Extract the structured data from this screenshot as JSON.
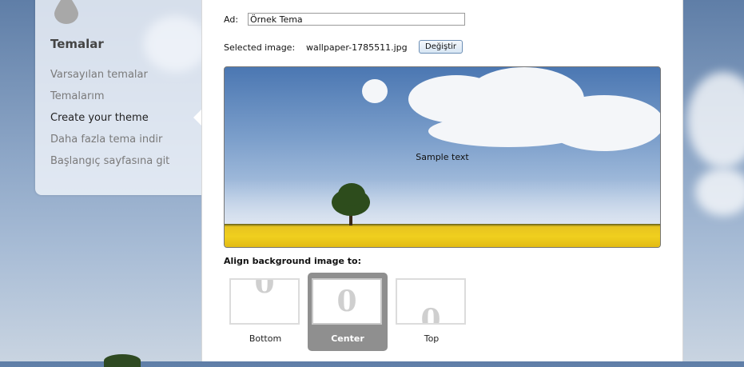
{
  "sidebar": {
    "title": "Temalar",
    "items": [
      {
        "label": "Varsayılan temalar"
      },
      {
        "label": "Temalarım"
      },
      {
        "label": "Create your theme",
        "active": true
      },
      {
        "label": "Daha fazla tema indir"
      },
      {
        "label": "Başlangıç sayfasına git"
      }
    ]
  },
  "form": {
    "name_label": "Ad:",
    "name_value": "Örnek Tema",
    "selected_label": "Selected image:",
    "filename": "wallpaper-1785511.jpg",
    "change_button": "Değiştir"
  },
  "preview": {
    "sample_text": "Sample text"
  },
  "align": {
    "title": "Align background image to:",
    "options": [
      {
        "label": "Bottom",
        "selected": false
      },
      {
        "label": "Center",
        "selected": true
      },
      {
        "label": "Top",
        "selected": false
      }
    ],
    "thumb_glyph": "0"
  },
  "icons": {
    "sidebar_logo": "drop-icon"
  },
  "colors": {
    "selected_option": "#8f8f8f",
    "button_border": "#6d8fb5"
  }
}
